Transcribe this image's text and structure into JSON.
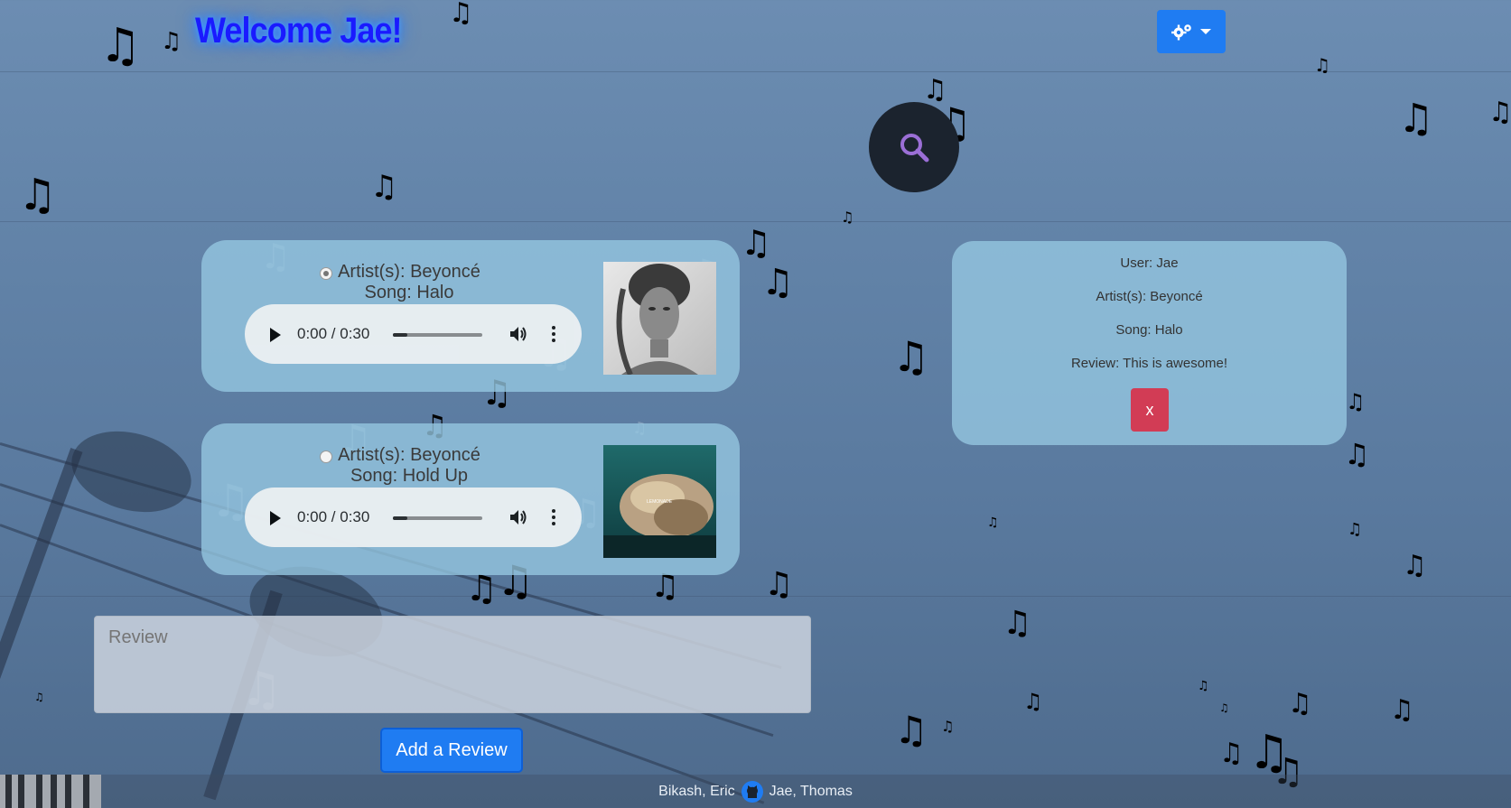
{
  "header": {
    "welcome": "Welcome Jae!",
    "settings_icon": "gears-icon",
    "search_icon": "search-icon"
  },
  "songs": [
    {
      "artist": "Artist(s): Beyoncé",
      "song": "Song: Halo",
      "selected": true,
      "player": {
        "time": "0:00 / 0:30",
        "progress": 0.16
      }
    },
    {
      "artist": "Artist(s): Beyoncé",
      "song": "Song: Hold Up",
      "selected": false,
      "player": {
        "time": "0:00 / 0:30",
        "progress": 0.16
      },
      "album_text": "LEMONADE"
    }
  ],
  "review_form": {
    "placeholder": "Review",
    "submit_label": "Add a Review"
  },
  "review_card": {
    "user": "User: Jae",
    "artist": "Artist(s): Beyoncé",
    "song": "Song: Halo",
    "review": "Review: This is awesome!",
    "delete_label": "x"
  },
  "footer": {
    "names_left": "Bikash, Eric",
    "names_right": "Jae, Thomas",
    "github_icon": "github-icon"
  },
  "colors": {
    "accent_blue": "#1f7cf2",
    "danger": "#d23c55",
    "welcome_text": "#1a1aff"
  }
}
